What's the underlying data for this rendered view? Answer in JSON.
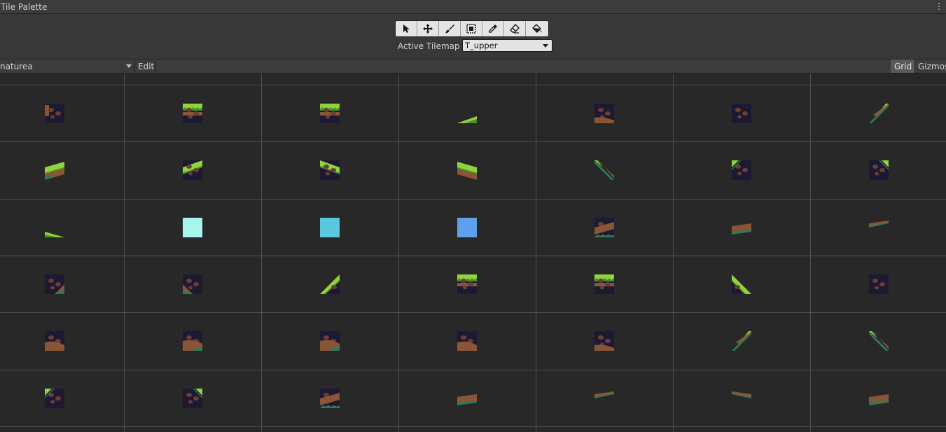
{
  "window": {
    "title": "Tile Palette",
    "menu_icon": "kebab-menu-icon"
  },
  "toolbar": {
    "tools": [
      {
        "name": "select-tool",
        "icon": "cursor-icon"
      },
      {
        "name": "move-tool",
        "icon": "move-icon"
      },
      {
        "name": "paint-tool",
        "icon": "brush-icon"
      },
      {
        "name": "box-fill-tool",
        "icon": "box-fill-icon"
      },
      {
        "name": "picker-tool",
        "icon": "eyedropper-icon"
      },
      {
        "name": "erase-tool",
        "icon": "eraser-icon"
      },
      {
        "name": "fill-tool",
        "icon": "paint-bucket-icon"
      }
    ],
    "active_tilemap_label": "Active Tilemap",
    "active_tilemap_value": "T_upper"
  },
  "palette_bar": {
    "palette_name": "naturea",
    "edit_label": "Edit",
    "grid_label": "Grid",
    "gizmos_label": "Gizmos"
  },
  "colors": {
    "dirt_bg": "#1e1933",
    "dirt_brown": "#8a5536",
    "rock": "#6b3f34",
    "grass": "#8ed43a",
    "grass_dark": "#4a8f2a",
    "leaf": "#2f7a55",
    "cyan_light": "#a7f5ec",
    "cyan": "#5cc8e0",
    "blue": "#5ea0ec"
  },
  "tiles": [
    [
      "dirt-full-left",
      "grass-top-full",
      "grass-top-full",
      "grass-slope-small-up",
      "dirt-full-bottom",
      "dirt-full-rocks",
      "edge-diagonal-up"
    ],
    [
      "grass-slope-up-left",
      "grass-slope-up-right",
      "grass-slope-down-left",
      "grass-slope-down-right",
      "edge-diagonal-down",
      "dirt-grass-corner",
      "dirt-grass-corner-right"
    ],
    [
      "grass-slope-small-down",
      "color-cyan-light",
      "color-cyan",
      "color-blue",
      "dirt-slope-up",
      "dirt-slope-up-small",
      "dirt-slope-thin"
    ],
    [
      "dirt-leaf-corner",
      "dirt-leaf-corner-left",
      "grass-triangle-up",
      "grass-top-full",
      "grass-top-full",
      "grass-triangle-down",
      "dirt-full-rocks"
    ],
    [
      "dirt-bottom-brown",
      "dirt-bottom-brown-leaf",
      "dirt-bottom-brown-leaf",
      "dirt-bottom-brown",
      "dirt-full-bottom",
      "edge-diagonal-up",
      "edge-diagonal-down"
    ],
    [
      "dirt-grass-corner",
      "dirt-grass-corner-right",
      "dirt-slope-up",
      "dirt-slope-up-small",
      "dirt-slope-thin",
      "dirt-slope-thin-down",
      "dirt-slope-up-small"
    ]
  ]
}
